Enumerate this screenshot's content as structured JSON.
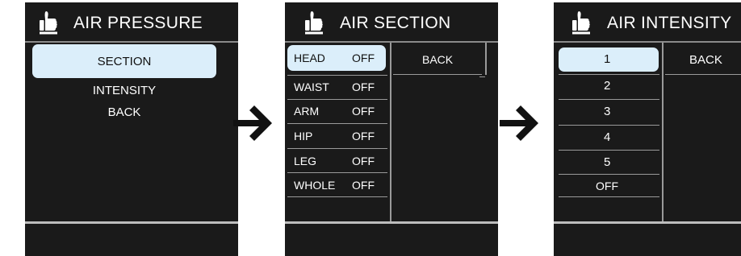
{
  "screen1": {
    "title": "AIR PRESSURE",
    "menu": [
      "SECTION",
      "INTENSITY",
      "BACK"
    ],
    "selected": "SECTION"
  },
  "screen2": {
    "title": "AIR SECTION",
    "items": [
      {
        "label": "HEAD",
        "value": "OFF"
      },
      {
        "label": "WAIST",
        "value": "OFF"
      },
      {
        "label": "ARM",
        "value": "OFF"
      },
      {
        "label": "HIP",
        "value": "OFF"
      },
      {
        "label": "LEG",
        "value": "OFF"
      },
      {
        "label": "WHOLE",
        "value": "OFF"
      }
    ],
    "selected": "HEAD",
    "back_label": "BACK"
  },
  "screen3": {
    "title": "AIR INTENSITY",
    "levels": [
      "1",
      "2",
      "3",
      "4",
      "5",
      "OFF"
    ],
    "selected": "1",
    "back_label": "BACK"
  },
  "icons": {
    "header_icon": "thumbs-up-icon",
    "transition_icon": "arrow-right-icon"
  },
  "colors": {
    "screen_bg": "#1a1a1a",
    "highlight": "#dbeefa",
    "text": "#ffffff"
  }
}
